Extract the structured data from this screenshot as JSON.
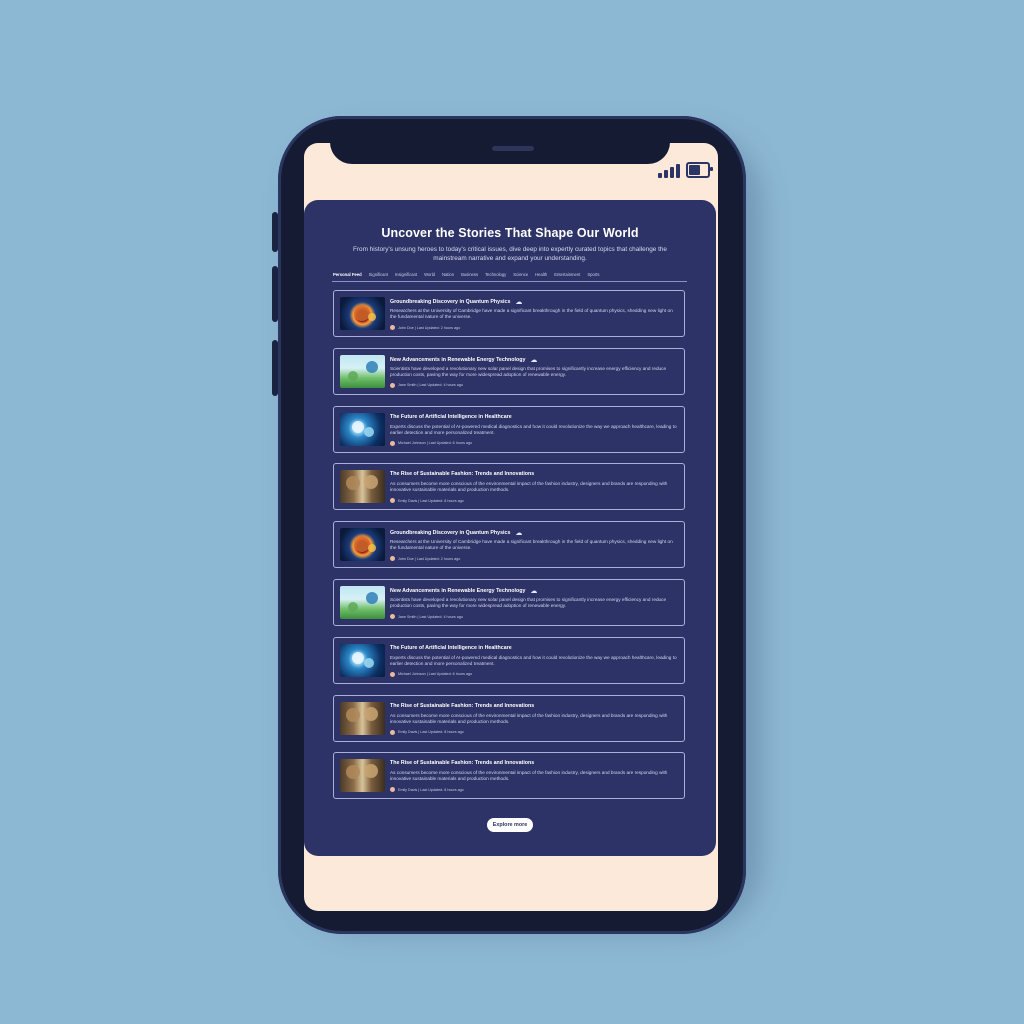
{
  "status_bar": {
    "signal_icon": "signal-bars-icon",
    "battery_icon": "battery-icon"
  },
  "header": {
    "title": "Uncover the Stories That Shape Our World",
    "subtitle": "From history's unsung heroes to today's critical issues, dive deep into expertly curated topics that challenge the mainstream narrative and expand your understanding."
  },
  "tabs": [
    {
      "label": "Personal Feed",
      "active": true
    },
    {
      "label": "Significant",
      "active": false
    },
    {
      "label": "Insignificant",
      "active": false
    },
    {
      "label": "World",
      "active": false
    },
    {
      "label": "Nation",
      "active": false
    },
    {
      "label": "Business",
      "active": false
    },
    {
      "label": "Technology",
      "active": false
    },
    {
      "label": "Science",
      "active": false
    },
    {
      "label": "Health",
      "active": false
    },
    {
      "label": "Entertainment",
      "active": false
    },
    {
      "label": "Sports",
      "active": false
    }
  ],
  "articles": [
    {
      "title": "Groundbreaking Discovery in Quantum Physics",
      "has_drop_icon": true,
      "description": "Researchers at the University of Cambridge have made a significant breakthrough in the field of quantum physics, shedding new light on the fundamental nature of the universe.",
      "meta": "John Doe | Last Updated: 2 hours ago",
      "thumb": "quantum"
    },
    {
      "title": "New Advancements in Renewable Energy Technology",
      "has_drop_icon": true,
      "description": "Scientists have developed a revolutionary new solar panel design that promises to significantly increase energy efficiency and reduce production costs, paving the way for more widespread adoption of renewable energy.",
      "meta": "Jane Smith | Last Updated: 4 hours ago",
      "thumb": "energy"
    },
    {
      "title": "The Future of Artificial Intelligence in Healthcare",
      "has_drop_icon": false,
      "description": "Experts discuss the potential of AI-powered medical diagnostics and how it could revolutionize the way we approach healthcare, leading to earlier detection and more personalized treatment.",
      "meta": "Michael Johnson | Last Updated: 6 hours ago",
      "thumb": "ai"
    },
    {
      "title": "The Rise of Sustainable Fashion: Trends and Innovations",
      "has_drop_icon": false,
      "description": "As consumers become more conscious of the environmental impact of the fashion industry, designers and brands are responding with innovative sustainable materials and production methods.",
      "meta": "Emily Davis | Last Updated: 8 hours ago",
      "thumb": "fashion"
    },
    {
      "title": "Groundbreaking Discovery in Quantum Physics",
      "has_drop_icon": true,
      "description": "Researchers at the University of Cambridge have made a significant breakthrough in the field of quantum physics, shedding new light on the fundamental nature of the universe.",
      "meta": "John Doe | Last Updated: 2 hours ago",
      "thumb": "quantum"
    },
    {
      "title": "New Advancements in Renewable Energy Technology",
      "has_drop_icon": true,
      "description": "Scientists have developed a revolutionary new solar panel design that promises to significantly increase energy efficiency and reduce production costs, paving the way for more widespread adoption of renewable energy.",
      "meta": "Jane Smith | Last Updated: 4 hours ago",
      "thumb": "energy"
    },
    {
      "title": "The Future of Artificial Intelligence in Healthcare",
      "has_drop_icon": false,
      "description": "Experts discuss the potential of AI-powered medical diagnostics and how it could revolutionize the way we approach healthcare, leading to earlier detection and more personalized treatment.",
      "meta": "Michael Johnson | Last Updated: 6 hours ago",
      "thumb": "ai"
    },
    {
      "title": "The Rise of Sustainable Fashion: Trends and Innovations",
      "has_drop_icon": false,
      "description": "As consumers become more conscious of the environmental impact of the fashion industry, designers and brands are responding with innovative sustainable materials and production methods.",
      "meta": "Emily Davis | Last Updated: 8 hours ago",
      "thumb": "fashion"
    },
    {
      "title": "The Rise of Sustainable Fashion: Trends and Innovations",
      "has_drop_icon": false,
      "description": "As consumers become more conscious of the environmental impact of the fashion industry, designers and brands are responding with innovative sustainable materials and production methods.",
      "meta": "Emily Davis | Last Updated: 8 hours ago",
      "thumb": "fashion"
    }
  ],
  "footer": {
    "explore_label": "Explore more"
  },
  "colors": {
    "background": "#8db8d4",
    "panel": "#2d3366",
    "screen": "#fde9d9",
    "accent": "#ffffff"
  }
}
